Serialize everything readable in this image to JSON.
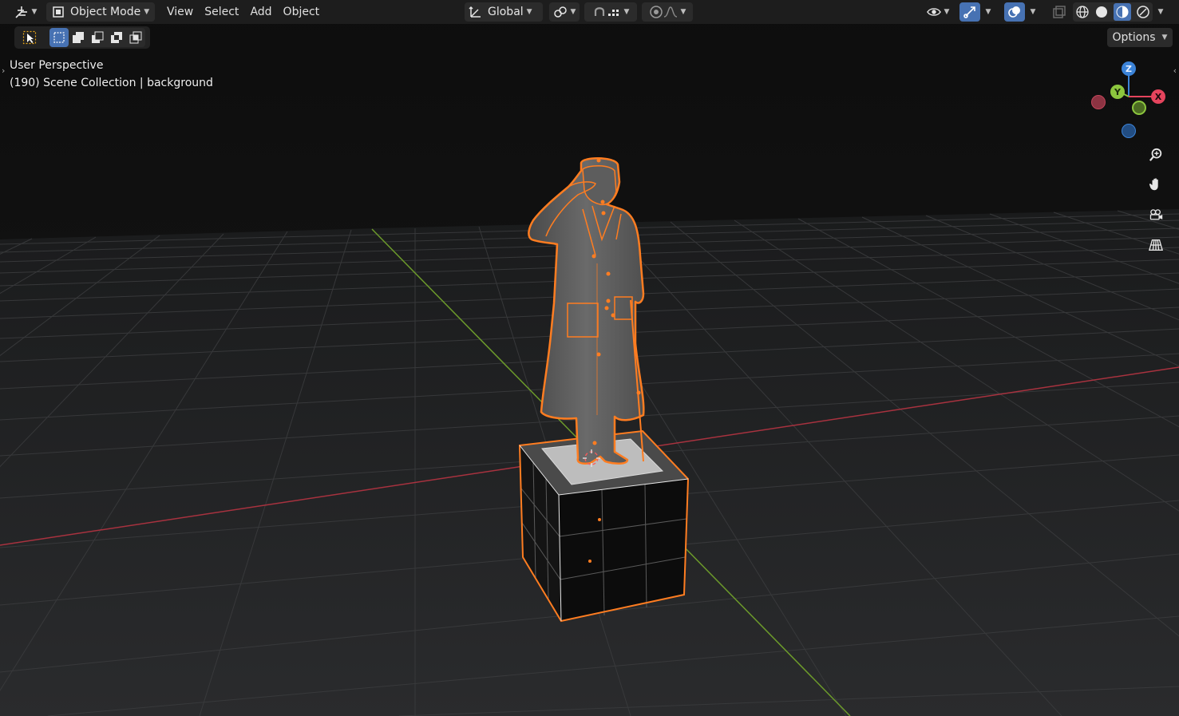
{
  "header": {
    "mode_label": "Object Mode",
    "menus": [
      "View",
      "Select",
      "Add",
      "Object"
    ],
    "orientation_label": "Global"
  },
  "toolbar": {
    "options_label": "Options"
  },
  "viewport": {
    "perspective_label": "User Perspective",
    "collection_label": "(190) Scene Collection | background"
  },
  "gizmo": {
    "x_label": "X",
    "y_label": "Y",
    "z_label": "Z"
  },
  "colors": {
    "x_axis": "#e5445d",
    "y_axis": "#8cc63e",
    "z_axis": "#3b83d8",
    "selection": "#ff7d21",
    "accent_blue": "#4772b3",
    "background": "#111111"
  },
  "icons": [
    "editor-type-icon",
    "object-mode-icon",
    "orientation-icon",
    "pivot-icon",
    "snap-icon",
    "snap-increment-icon",
    "proportional-edit-icon",
    "falloff-icon",
    "visibility-icon",
    "gizmo-icon",
    "overlay-icon",
    "xray-icon",
    "wireframe-shading-icon",
    "solid-shading-icon",
    "material-shading-icon",
    "rendered-shading-icon",
    "select-tool-icon",
    "select-mode-new-icon",
    "select-mode-extend-icon",
    "select-mode-subtract-icon",
    "select-mode-difference-icon",
    "select-mode-intersect-icon",
    "zoom-icon",
    "pan-hand-icon",
    "camera-view-icon",
    "grid-ortho-icon"
  ]
}
